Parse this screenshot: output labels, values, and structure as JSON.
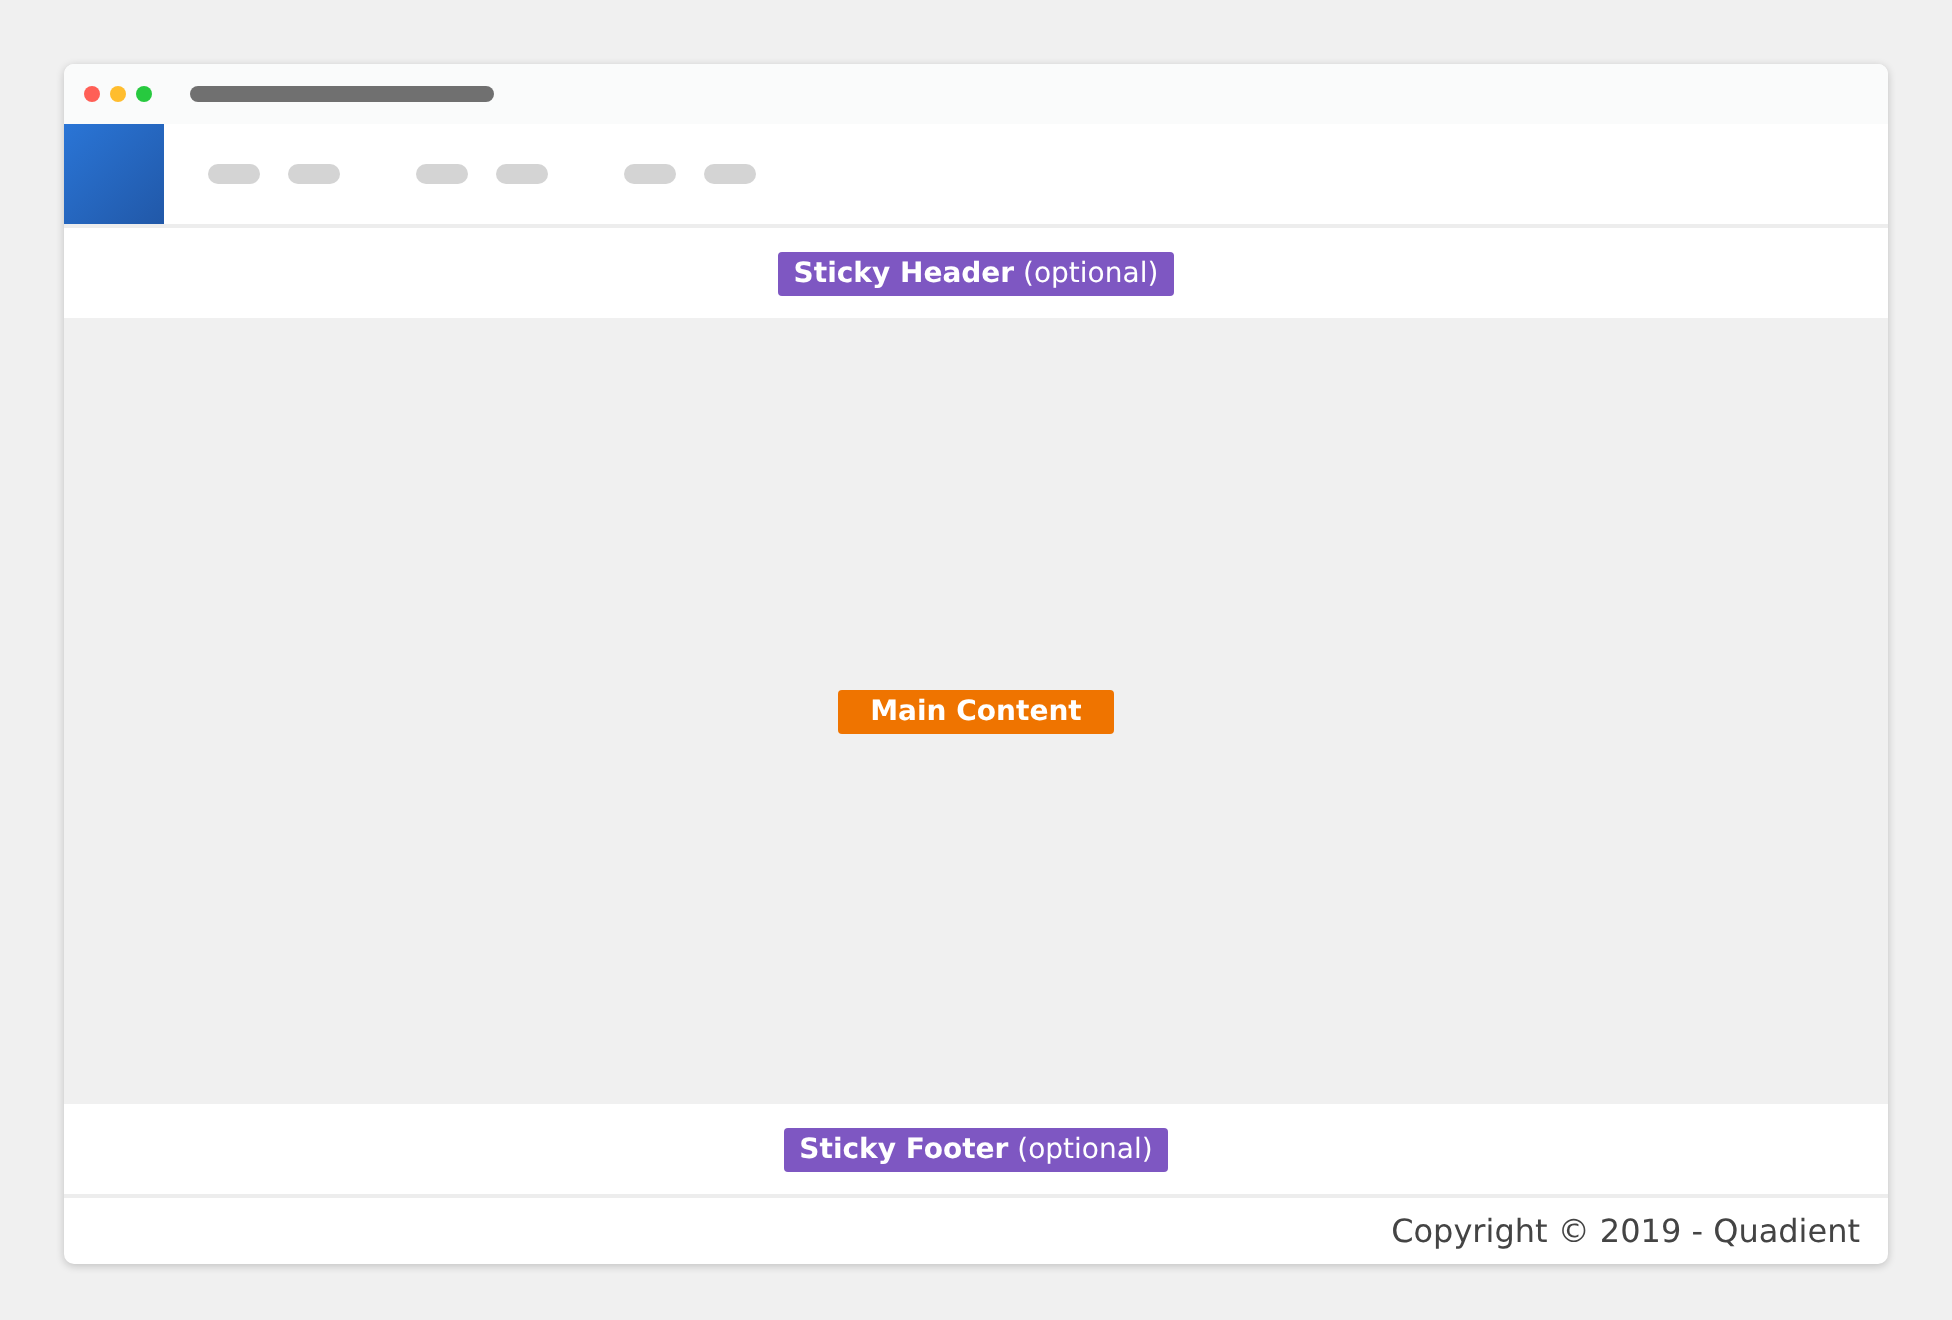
{
  "regions": [
    {
      "kind": "header",
      "label": "**Sticky Header** (optional)"
    },
    {
      "kind": "main",
      "label": "**Main Content**"
    },
    {
      "kind": "footer",
      "label": "**Sticky Footer** (optional)"
    }
  ],
  "footer": {
    "copyright": "Copyright © 2019 - Quadient"
  }
}
